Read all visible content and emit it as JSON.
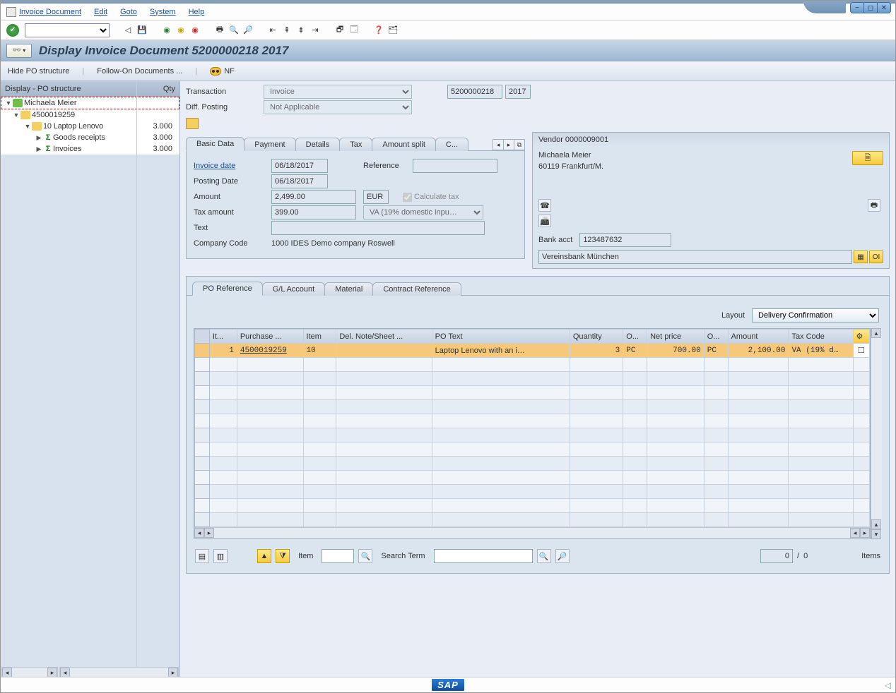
{
  "menu": {
    "items": [
      "Invoice Document",
      "Edit",
      "Goto",
      "System",
      "Help"
    ]
  },
  "title": "Display Invoice Document 5200000218 2017",
  "actionbar": {
    "hide_po": "Hide PO structure",
    "follow_on": "Follow-On Documents ...",
    "nf": "NF"
  },
  "tree": {
    "header_label": "Display - PO structure",
    "header_qty": "Qty",
    "rows": [
      {
        "label": "Michaela Meier",
        "qty": ""
      },
      {
        "label": "4500019259",
        "qty": ""
      },
      {
        "label": "10 Laptop Lenovo",
        "qty": "3.000"
      },
      {
        "label": "Goods receipts",
        "qty": "3.000"
      },
      {
        "label": "Invoices",
        "qty": "3.000"
      }
    ]
  },
  "header_form": {
    "transaction_label": "Transaction",
    "transaction_value": "Invoice",
    "doc_number": "5200000218",
    "doc_year": "2017",
    "diff_posting_label": "Diff. Posting",
    "diff_posting_value": "Not Applicable"
  },
  "tabs_top": [
    "Basic Data",
    "Payment",
    "Details",
    "Tax",
    "Amount split",
    "C..."
  ],
  "basic": {
    "invoice_date_label": "Invoice date",
    "invoice_date": "06/18/2017",
    "reference_label": "Reference",
    "reference": "",
    "posting_date_label": "Posting Date",
    "posting_date": "06/18/2017",
    "amount_label": "Amount",
    "amount": "2,499.00",
    "currency": "EUR",
    "calc_tax_label": "Calculate tax",
    "tax_amount_label": "Tax amount",
    "tax_amount": "399.00",
    "tax_code": "VA (19% domestic inpu…",
    "text_label": "Text",
    "text": "",
    "company_code_label": "Company Code",
    "company_code": "1000 IDES Demo company Roswell"
  },
  "vendor": {
    "header": "Vendor 0000009001",
    "name": "Michaela Meier",
    "city": "60119 Frankfurt/M.",
    "bank_acct_label": "Bank acct",
    "bank_acct": "123487632",
    "bank_name": "Vereinsbank München",
    "oi": "OI"
  },
  "tabs_bottom": [
    "PO Reference",
    "G/L Account",
    "Material",
    "Contract Reference"
  ],
  "layout_label": "Layout",
  "layout_value": "Delivery Confirmation",
  "grid": {
    "headers": [
      "It...",
      "Purchase ...",
      "Item",
      "Del. Note/Sheet ...",
      "PO Text",
      "Quantity",
      "O...",
      "Net price",
      "O...",
      "Amount",
      "Tax Code"
    ],
    "row": {
      "it": "1",
      "po": "4500019259",
      "item": "10",
      "deln": "",
      "po_text": "Laptop Lenovo with an i…",
      "qty": "3",
      "o1": "PC",
      "net": "700.00",
      "o2": "PC",
      "amount": "2,100.00",
      "tax": "VA (19% d…"
    }
  },
  "footer": {
    "item_label": "Item",
    "search_label": "Search Term",
    "count": "0",
    "sep": "/",
    "total": "0",
    "items_word": "Items"
  }
}
